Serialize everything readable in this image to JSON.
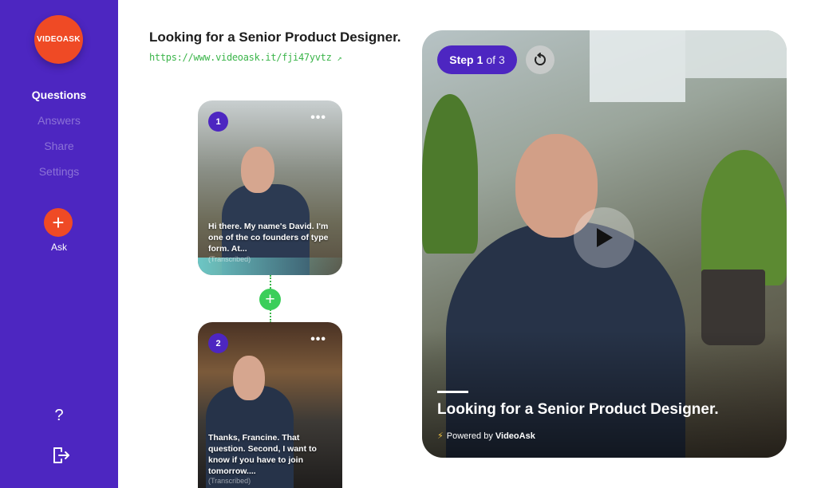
{
  "sidebar": {
    "logo_text": "VIDEOASK",
    "nav": [
      {
        "label": "Questions",
        "active": true
      },
      {
        "label": "Answers",
        "active": false
      },
      {
        "label": "Share",
        "active": false
      },
      {
        "label": "Settings",
        "active": false
      }
    ],
    "ask_symbol": "+",
    "ask_label": "Ask",
    "help_symbol": "?",
    "icons": {
      "help": "question-icon",
      "logout": "logout-icon"
    }
  },
  "question": {
    "title": "Looking for a Senior Product Designer.",
    "link": "https://www.videoask.it/fji47yvtz",
    "link_arrow": "↗"
  },
  "steps": [
    {
      "number": "1",
      "menu": "•••",
      "caption": "Hi there. My name's David. I'm one of the co founders of type form. At...",
      "status": "(Transcribed)"
    },
    {
      "number": "2",
      "menu": "•••",
      "caption": "Thanks, Francine. That question. Second, I want to know if you have to join tomorrow....",
      "status": "(Transcribed)"
    }
  ],
  "add_step_symbol": "+",
  "preview": {
    "step_word": "Step",
    "step_current": "1",
    "step_total_text": "of 3",
    "title": "Looking for a Senior Product Designer.",
    "powered_prefix": "Powered by",
    "powered_brand": "VideoAsk",
    "bolt": "⚡"
  },
  "colors": {
    "sidebar": "#4d26c1",
    "brand_orange": "#ef4a25",
    "link_green": "#3bb54a",
    "add_green": "#3bce5a"
  }
}
